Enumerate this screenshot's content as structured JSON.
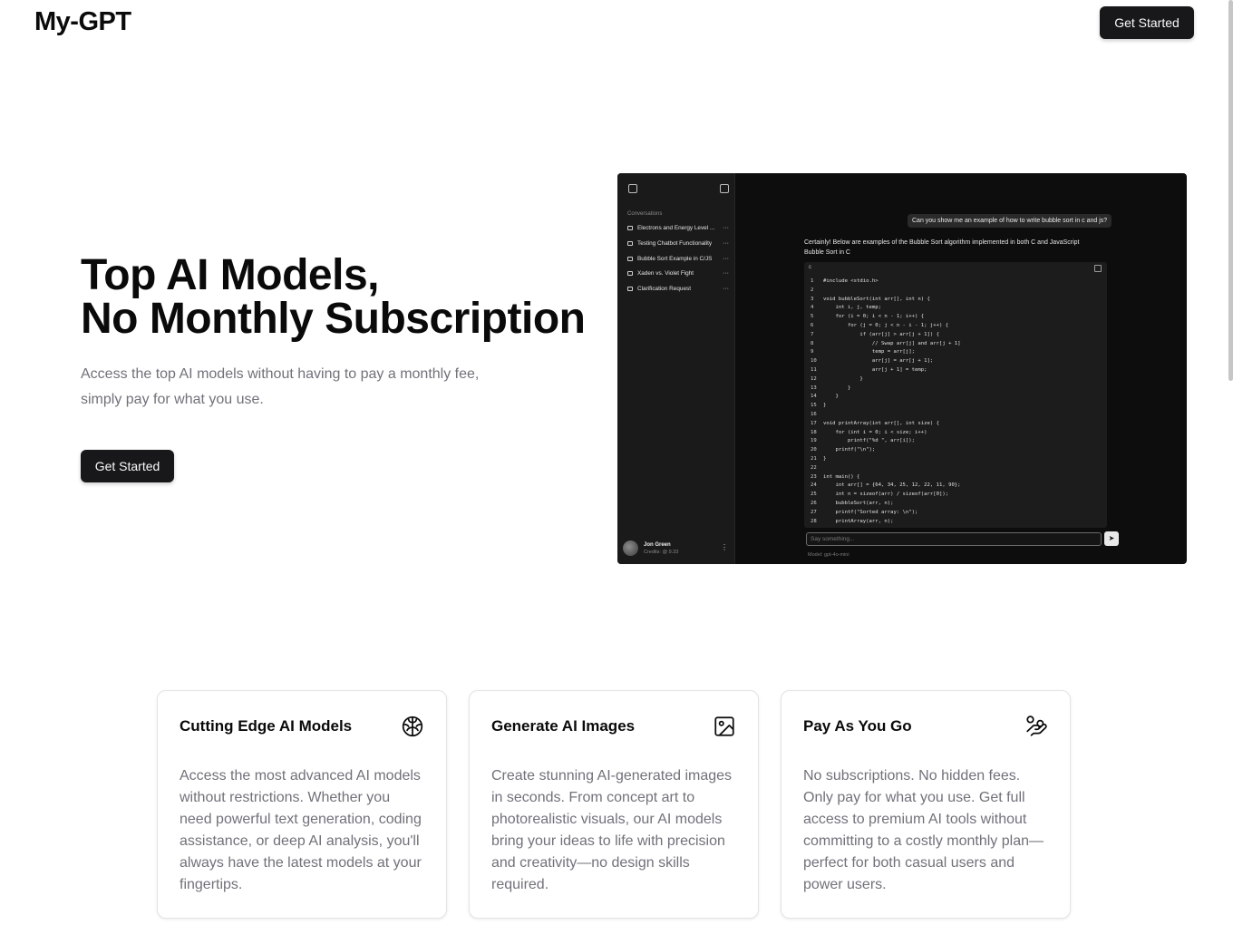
{
  "header": {
    "logo": "My-GPT",
    "cta": "Get Started"
  },
  "hero": {
    "title_line1": "Top AI Models,",
    "title_line2": "No Monthly Subscription",
    "subtitle": "Access the top AI models without having to pay a monthly fee, simply pay for what you use.",
    "cta": "Get Started"
  },
  "preview": {
    "sidebar_heading": "Conversations",
    "conversations": [
      "Electrons and Energy Level ...",
      "Testing Chatbot Functionality",
      "Bubble Sort Example in C/JS",
      "Xaden vs. Violet Fight",
      "Clarification Request"
    ],
    "user_name": "Jon Green",
    "user_credits": "Credits: @ 9.33",
    "user_message": "Can you show me an example of how to write bubble sort in c and js?",
    "assistant_line1": "Certainly! Below are examples of the Bubble Sort algorithm implemented in both C and JavaScript",
    "assistant_line2": "Bubble Sort in C",
    "code_lang": "c",
    "code_lines": [
      "#include <stdio.h>",
      "",
      "void bubbleSort(int arr[], int n) {",
      "    int i, j, temp;",
      "    for (i = 0; i < n - 1; i++) {",
      "        for (j = 0; j < n - i - 1; j++) {",
      "            if (arr[j] > arr[j + 1]) {",
      "                // Swap arr[j] and arr[j + 1]",
      "                temp = arr[j];",
      "                arr[j] = arr[j + 1];",
      "                arr[j + 1] = temp;",
      "            }",
      "        }",
      "    }",
      "}",
      "",
      "void printArray(int arr[], int size) {",
      "    for (int i = 0; i < size; i++)",
      "        printf(\"%d \", arr[i]);",
      "    printf(\"\\n\");",
      "}",
      "",
      "int main() {",
      "    int arr[] = {64, 34, 25, 12, 22, 11, 90};",
      "    int n = sizeof(arr) / sizeof(arr[0]);",
      "    bubbleSort(arr, n);",
      "    printf(\"Sorted array: \\n\");",
      "    printArray(arr, n);"
    ],
    "input_placeholder": "Say something...",
    "model_label": "Model:  gpt-4o-mini"
  },
  "features": [
    {
      "title": "Cutting Edge AI Models",
      "icon": "brain-icon",
      "text": "Access the most advanced AI models without restrictions. Whether you need powerful text generation, coding assistance, or deep AI analysis, you'll always have the latest models at your fingertips."
    },
    {
      "title": "Generate AI Images",
      "icon": "image-icon",
      "text": "Create stunning AI-generated images in seconds. From concept art to photorealistic visuals, our AI models bring your ideas to life with precision and creativity—no design skills required."
    },
    {
      "title": "Pay As You Go",
      "icon": "hand-coins-icon",
      "text": "No subscriptions. No hidden fees. Only pay for what you use. Get full access to premium AI tools without committing to a costly monthly plan—perfect for both casual users and power users."
    }
  ]
}
